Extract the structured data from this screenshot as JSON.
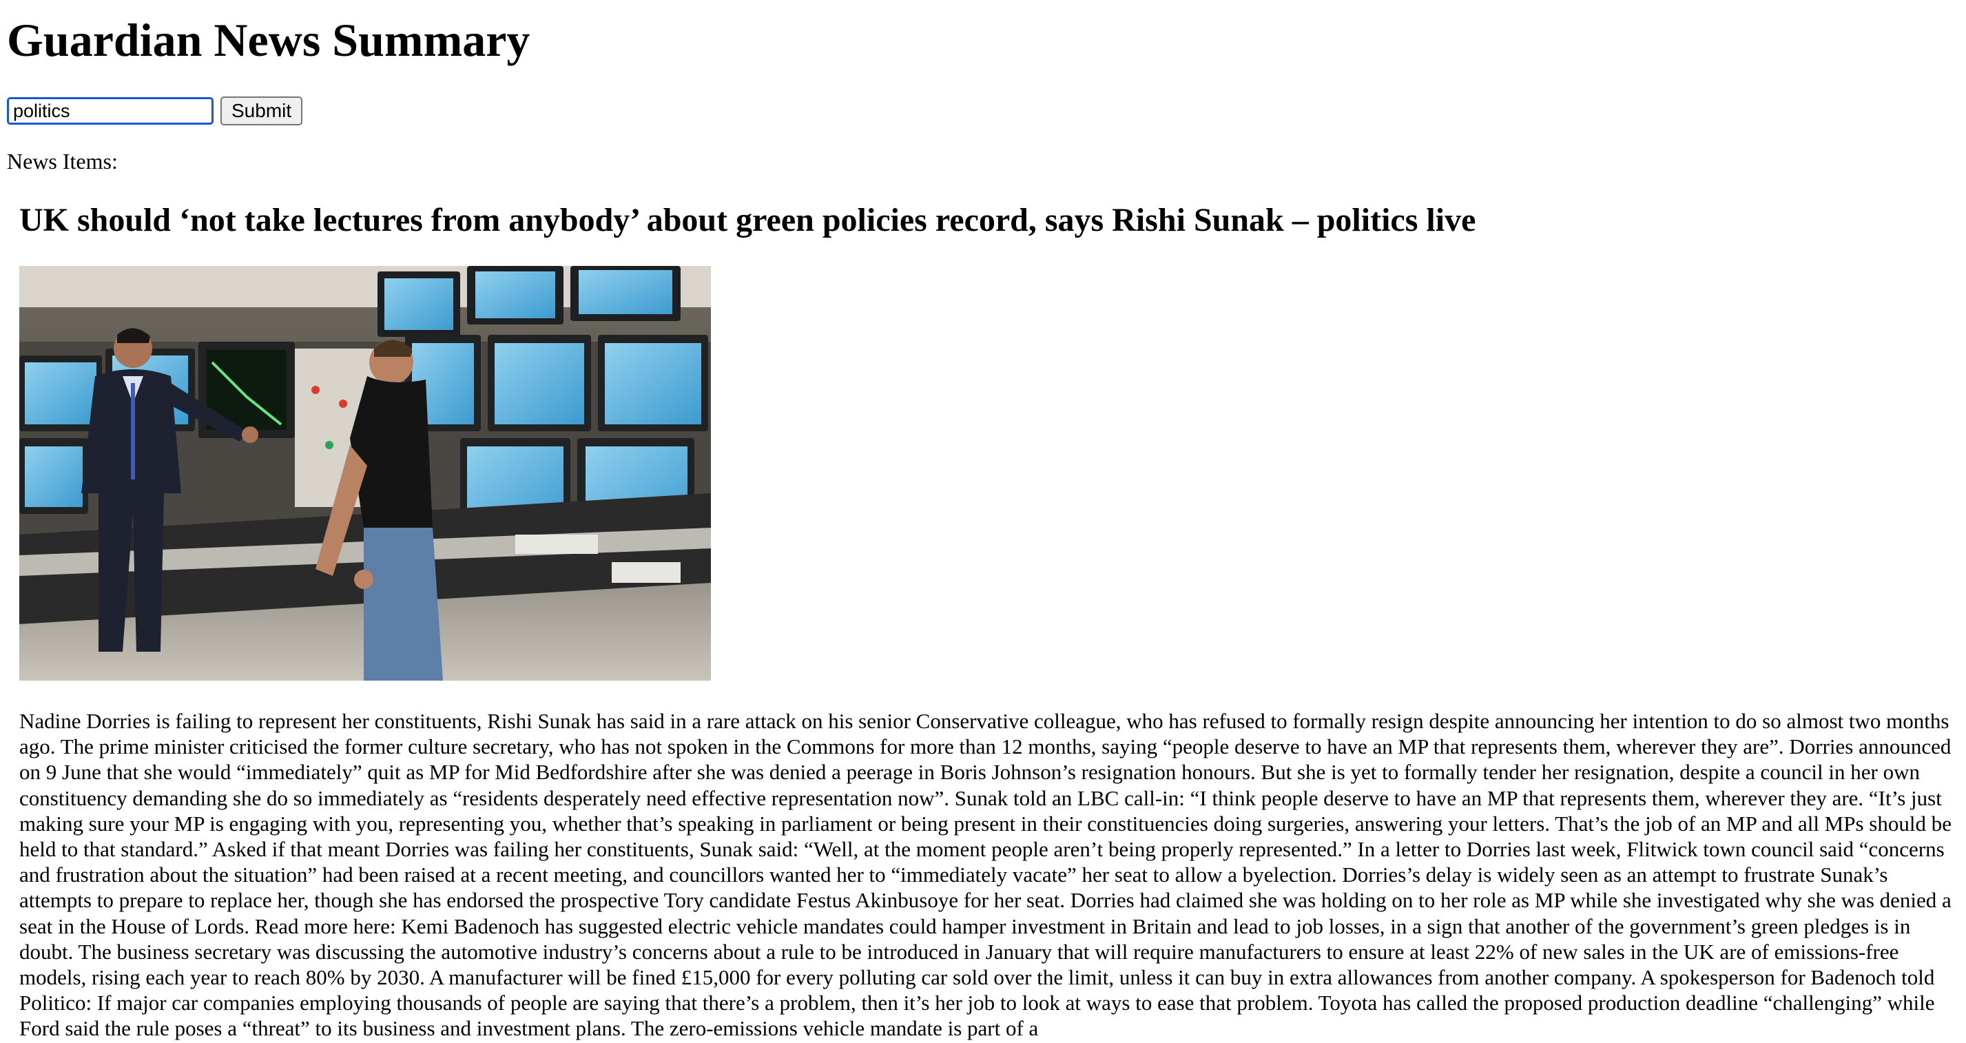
{
  "page": {
    "title": "Guardian News Summary"
  },
  "search": {
    "value": "politics",
    "submit_label": "Submit"
  },
  "news": {
    "label": "News Items:",
    "items": [
      {
        "headline": "UK should ‘not take lectures from anybody’ about green policies record, says Rishi Sunak – politics live",
        "body": "Nadine Dorries is failing to represent her constituents, Rishi Sunak has said in a rare attack on his senior Conservative colleague, who has refused to formally resign despite announcing her intention to do so almost two months ago. The prime minister criticised the former culture secretary, who has not spoken in the Commons for more than 12 months, saying “people deserve to have an MP that represents them, wherever they are”. Dorries announced on 9 June that she would “immediately” quit as MP for Mid Bedfordshire after she was denied a peerage in Boris Johnson’s resignation honours. But she is yet to formally tender her resignation, despite a council in her own constituency demanding she do so immediately as “residents desperately need effective representation now”. Sunak told an LBC call-in: “I think people deserve to have an MP that represents them, wherever they are. “It’s just making sure your MP is engaging with you, representing you, whether that’s speaking in parliament or being present in their constituencies doing surgeries, answering your letters. That’s the job of an MP and all MPs should be held to that standard.” Asked if that meant Dorries was failing her constituents, Sunak said: “Well, at the moment people aren’t being properly represented.” In a letter to Dorries last week, Flitwick town council said “concerns and frustration about the situation” had been raised at a recent meeting, and councillors wanted her to “immediately vacate” her seat to allow a byelection. Dorries’s delay is widely seen as an attempt to frustrate Sunak’s attempts to prepare to replace her, though she has endorsed the prospective Tory candidate Festus Akinbusoye for her seat. Dorries had claimed she was holding on to her role as MP while she investigated why she was denied a seat in the House of Lords. Read more here: Kemi Badenoch has suggested electric vehicle mandates could hamper investment in Britain and lead to job losses, in a sign that another of the government’s green pledges is in doubt. The business secretary was discussing the automotive industry’s concerns about a rule to be introduced in January that will require manufacturers to ensure at least 22% of new sales in the UK are of emissions-free models, rising each year to reach 80% by 2030. A manufacturer will be fined £15,000 for every polluting car sold over the limit, unless it can buy in extra allowances from another company. A spokesperson for Badenoch told Politico: If major car companies employing thousands of people are saying that there’s a problem, then it’s her job to look at ways to ease that problem. Toyota has called the proposed production deadline “challenging” while Ford said the rule poses a “threat” to its business and investment plans. The zero-emissions vehicle mandate is part of a"
      }
    ]
  }
}
